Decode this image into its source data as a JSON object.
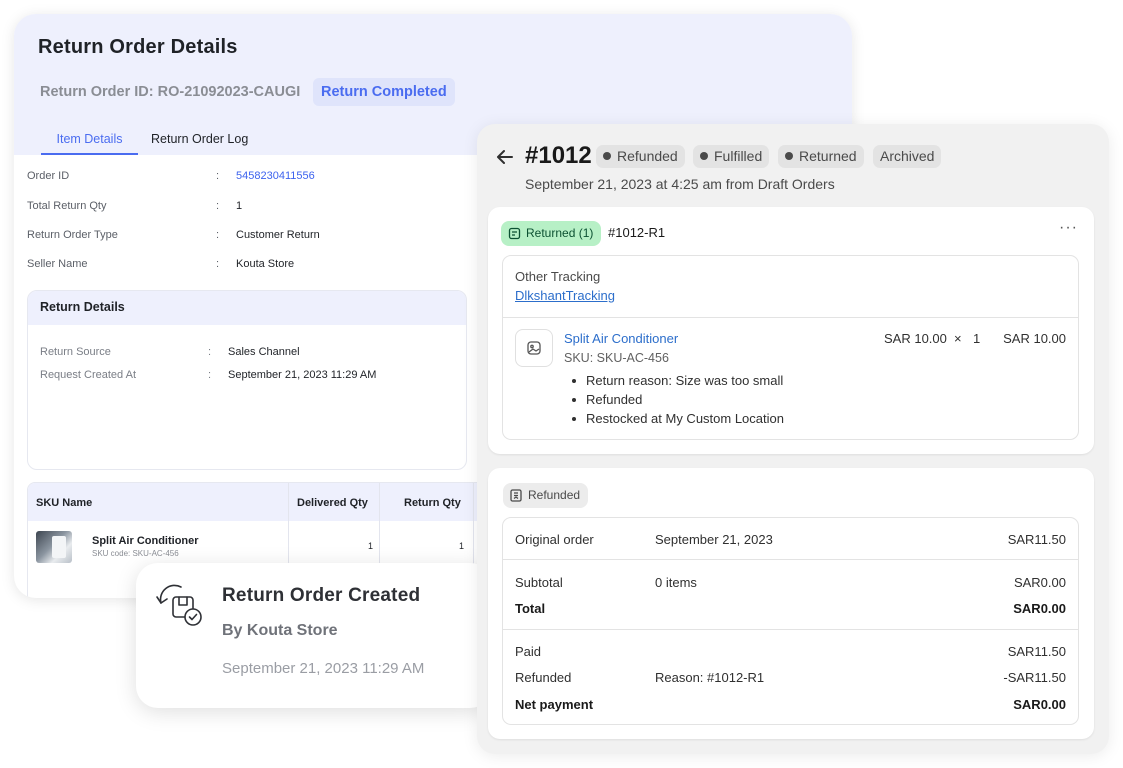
{
  "return_order": {
    "title": "Return Order Details",
    "id_text": "Return Order ID: RO-21092023-CAUGI",
    "status_badge": "Return Completed",
    "tabs": [
      "Item Details",
      "Return Order Log"
    ],
    "fields": [
      {
        "label": "Order ID",
        "value": "5458230411556"
      },
      {
        "label": "Total Return Qty",
        "value": "1"
      },
      {
        "label": "Return Order Type",
        "value": "Customer Return"
      },
      {
        "label": "Seller Name",
        "value": "Kouta Store"
      }
    ],
    "separator": ":",
    "return_details": {
      "heading": "Return Details",
      "rows": [
        {
          "label": "Return Source",
          "value": "Sales Channel"
        },
        {
          "label": "Request Created At",
          "value": "September 21, 2023 11:29 AM"
        }
      ]
    },
    "sku_table": {
      "headers": [
        "SKU Name",
        "Delivered Qty",
        "Return Qty"
      ],
      "rows": [
        {
          "name": "Split Air Conditioner",
          "code": "SKU code: SKU-AC-456",
          "delivered": "1",
          "returned": "1"
        }
      ]
    }
  },
  "created_toast": {
    "icon": "return-created-icon",
    "title": "Return Order Created",
    "by": "By Kouta Store",
    "date": "September 21, 2023 11:29 AM"
  },
  "order": {
    "back_icon": "arrow-left-icon",
    "number": "#1012",
    "pills": [
      "Refunded",
      "Fulfilled",
      "Returned",
      "Archived"
    ],
    "subtitle": "September 21, 2023 at 4:25 am from Draft Orders",
    "returned_card": {
      "badge": "Returned (1)",
      "return_id": "#1012-R1",
      "more_icon": "···",
      "tracking_label": "Other Tracking",
      "tracking_link": "DlkshantTracking",
      "item": {
        "name": "Split Air Conditioner",
        "sku": "SKU: SKU-AC-456",
        "price": "SAR 10.00",
        "times": "×",
        "qty": "1",
        "total": "SAR 10.00",
        "notes": [
          "Return reason: Size was too small",
          "Refunded",
          "Restocked at My Custom Location"
        ]
      }
    },
    "refund_card": {
      "badge": "Refunded",
      "original_order": {
        "label": "Original order",
        "date": "September 21, 2023",
        "amount": "SAR11.50"
      },
      "subtotal": {
        "label": "Subtotal",
        "items": "0 items",
        "amount": "SAR0.00"
      },
      "total": {
        "label": "Total",
        "amount": "SAR0.00"
      },
      "paid": {
        "label": "Paid",
        "amount": "SAR11.50"
      },
      "refunded": {
        "label": "Refunded",
        "reason": "Reason: #1012-R1",
        "amount": "-SAR11.50"
      },
      "net_payment": {
        "label": "Net payment",
        "amount": "SAR0.00"
      }
    }
  },
  "colors": {
    "accent_blue": "#4a6cf0",
    "header_tint": "#eef0fd",
    "link_blue": "#2c6ecb",
    "returned_green_bg": "#b7f0c6",
    "returned_green_text": "#0c5132"
  }
}
